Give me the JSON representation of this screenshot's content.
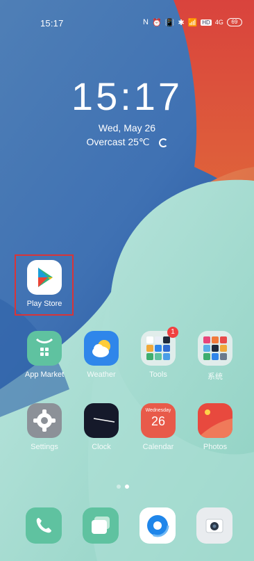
{
  "status_bar": {
    "time": "15:17",
    "indicators": [
      "N",
      "⏰",
      "📳",
      "✱",
      "📶"
    ],
    "hd_label": "HD",
    "signal_label": "4G",
    "battery": "69"
  },
  "lockscreen": {
    "clock": "15:17",
    "date": "Wed, May 26",
    "weather": "Overcast 25℃"
  },
  "apps": {
    "row1": [
      {
        "label": "Play Store"
      }
    ],
    "row2": [
      {
        "label": "App Market"
      },
      {
        "label": "Weather"
      },
      {
        "label": "Tools",
        "badge": "1"
      },
      {
        "label": "系统"
      }
    ],
    "row3": [
      {
        "label": "Settings"
      },
      {
        "label": "Clock"
      },
      {
        "label": "Calendar",
        "day_name": "Wednesday",
        "day_num": "26"
      },
      {
        "label": "Photos"
      }
    ]
  },
  "dock": [
    {
      "icon": "phone-icon"
    },
    {
      "icon": "messages-icon"
    },
    {
      "icon": "browser-icon"
    },
    {
      "icon": "camera-icon"
    }
  ],
  "page_indicator": {
    "pages": 2,
    "current": 2
  },
  "colors": {
    "highlight": "#d93437",
    "app_green": "#5fc2a0",
    "weather_blue": "#2f86ea",
    "calendar_red": "#e85a4a"
  }
}
